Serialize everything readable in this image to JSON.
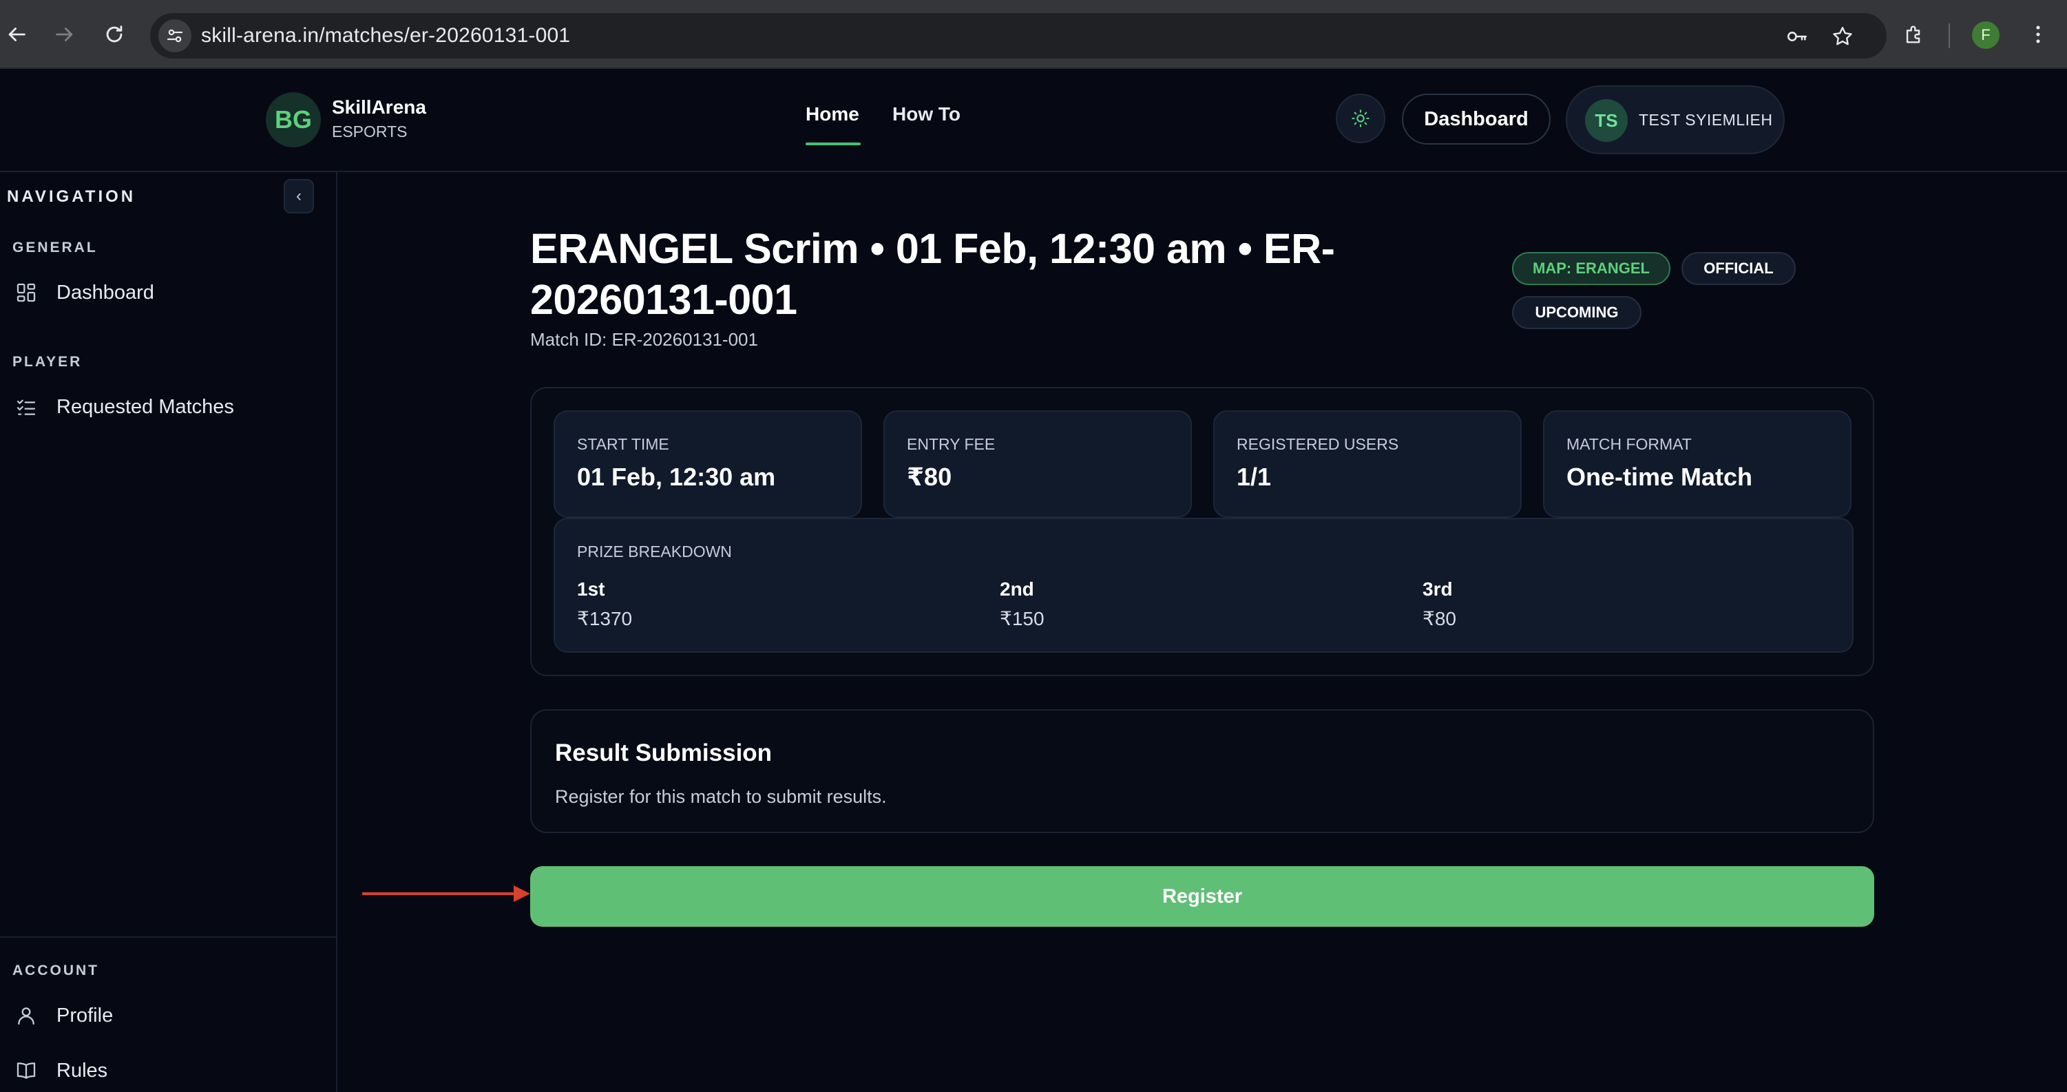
{
  "browser": {
    "url": "skill-arena.in/matches/er-20260131-001",
    "profile_initial": "F"
  },
  "header": {
    "logo_initials": "BG",
    "brand_name": "SkillArena",
    "brand_sub": "ESPORTS",
    "nav": [
      {
        "label": "Home",
        "active": true
      },
      {
        "label": "How To",
        "active": false
      }
    ],
    "dashboard_label": "Dashboard",
    "user": {
      "initials": "TS",
      "name": "TEST SYIEMLIEH"
    }
  },
  "sidebar": {
    "heading": "NAVIGATION",
    "collapse_glyph": "‹",
    "sections": [
      {
        "label": "GENERAL",
        "items": [
          {
            "label": "Dashboard",
            "icon": "grid-icon"
          }
        ]
      },
      {
        "label": "PLAYER",
        "items": [
          {
            "label": "Requested Matches",
            "icon": "checklist-icon"
          }
        ]
      },
      {
        "label": "ACCOUNT",
        "items": [
          {
            "label": "Profile",
            "icon": "user-icon"
          },
          {
            "label": "Rules",
            "icon": "book-icon"
          }
        ]
      }
    ]
  },
  "match": {
    "title": "ERANGEL Scrim • 01 Feb, 12:30 am • ER-20260131-001",
    "id_line": "Match ID: ER-20260131-001",
    "badges": [
      {
        "label": "MAP: ERANGEL",
        "accent": "#5dd17c"
      },
      {
        "label": "OFFICIAL"
      },
      {
        "label": "UPCOMING"
      }
    ],
    "stats": [
      {
        "label": "START TIME",
        "value": "01 Feb, 12:30 am"
      },
      {
        "label": "ENTRY FEE",
        "value": "₹80"
      },
      {
        "label": "REGISTERED USERS",
        "value": "1/1"
      },
      {
        "label": "MATCH FORMAT",
        "value": "One-time Match"
      }
    ],
    "prize": {
      "label": "PRIZE BREAKDOWN",
      "places": [
        {
          "place": "1st",
          "amount": "₹1370"
        },
        {
          "place": "2nd",
          "amount": "₹150"
        },
        {
          "place": "3rd",
          "amount": "₹80"
        }
      ]
    },
    "result": {
      "title": "Result Submission",
      "description": "Register for this match to submit results."
    },
    "register_label": "Register"
  },
  "colors": {
    "accent_green": "#5fbf75",
    "background": "#060913",
    "annotation_arrow": "#d8412b"
  }
}
